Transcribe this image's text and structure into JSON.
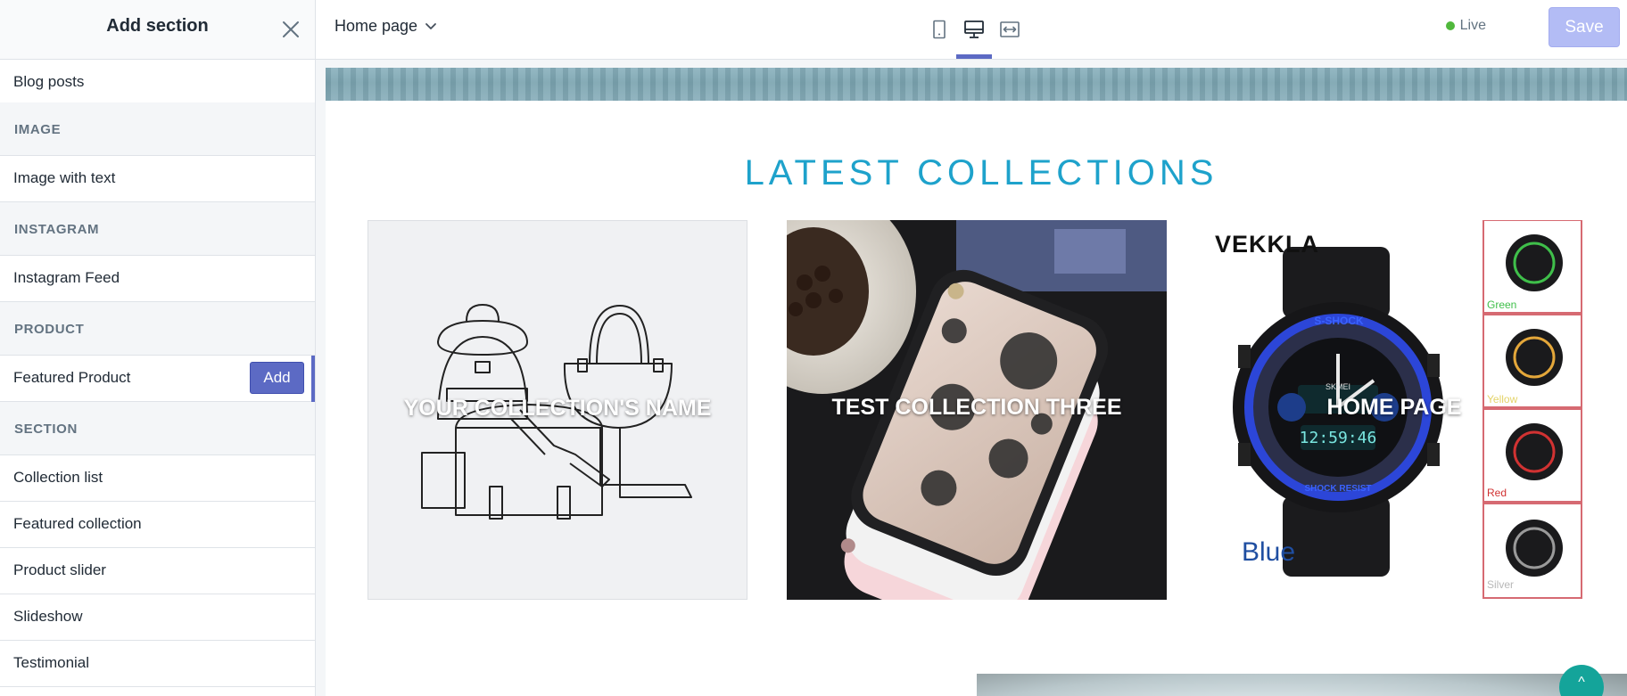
{
  "sidebar": {
    "title": "Add section",
    "items": [
      {
        "kind": "item",
        "label": "Blog posts"
      },
      {
        "kind": "group",
        "label": "IMAGE"
      },
      {
        "kind": "item",
        "label": "Image with text"
      },
      {
        "kind": "group",
        "label": "INSTAGRAM"
      },
      {
        "kind": "item",
        "label": "Instagram Feed"
      },
      {
        "kind": "group",
        "label": "PRODUCT"
      },
      {
        "kind": "item",
        "label": "Featured Product",
        "add_label": "Add"
      },
      {
        "kind": "group",
        "label": "SECTION"
      },
      {
        "kind": "item",
        "label": "Collection list"
      },
      {
        "kind": "item",
        "label": "Featured collection"
      },
      {
        "kind": "item",
        "label": "Product slider"
      },
      {
        "kind": "item",
        "label": "Slideshow"
      },
      {
        "kind": "item",
        "label": "Testimonial"
      }
    ]
  },
  "topbar": {
    "page": "Home page",
    "devices": [
      "mobile",
      "desktop",
      "fullscreen"
    ],
    "active_device": "desktop",
    "status": "Live",
    "save_label": "Save"
  },
  "preview": {
    "section_title": "LATEST COLLECTIONS",
    "collections": [
      {
        "name": "YOUR COLLECTION'S NAME"
      },
      {
        "name": "TEST COLLECTION THREE"
      },
      {
        "name": "HOME PAGE",
        "brand": "VEKKLA",
        "color_label": "Blue",
        "swatches": [
          "Green",
          "Yellow",
          "Red",
          "Silver"
        ],
        "watch_face": {
          "top": "S-SHOCK",
          "model": "SKMEI",
          "digital": "12:59:46",
          "bottom": "SHOCK RESIST"
        }
      }
    ]
  },
  "colors": {
    "accent": "#5c6ac4",
    "title": "#1ea2cb",
    "live": "#50b83c",
    "scroll_top": "#14a49a"
  }
}
